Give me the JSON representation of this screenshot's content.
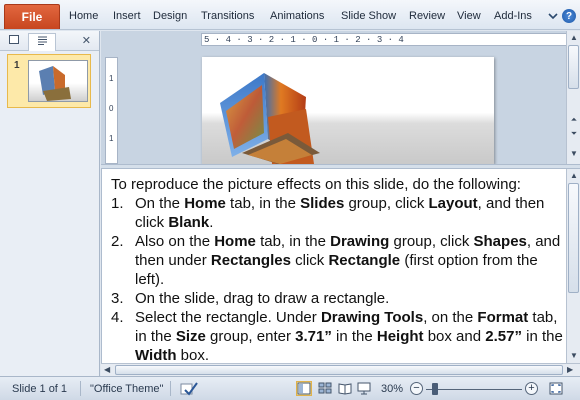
{
  "ribbon": {
    "file_label": "File",
    "tabs": [
      "Home",
      "Insert",
      "Design",
      "Transitions",
      "Animations",
      "Slide Show",
      "Review",
      "View",
      "Add-Ins"
    ],
    "help_label": "?"
  },
  "slides_pane": {
    "thumbnail_number": "1"
  },
  "ruler": {
    "horizontal": "5 · 4 · 3 · 2 · 1 · 0 · 1 · 2 · 3 · 4",
    "vertical": [
      "1",
      "0",
      "1"
    ]
  },
  "notes": {
    "intro": "To reproduce the picture effects on this slide, do the following:",
    "steps": [
      {
        "num": "1.",
        "parts": [
          {
            "t": "On the "
          },
          {
            "b": "Home"
          },
          {
            "t": " tab, in the "
          },
          {
            "b": "Slides"
          },
          {
            "t": " group, click "
          },
          {
            "b": "Layout"
          },
          {
            "t": ", and then click "
          },
          {
            "b": "Blank"
          },
          {
            "t": "."
          }
        ]
      },
      {
        "num": "2.",
        "parts": [
          {
            "t": "Also on the "
          },
          {
            "b": "Home"
          },
          {
            "t": " tab, in the "
          },
          {
            "b": "Drawing"
          },
          {
            "t": " group, click "
          },
          {
            "b": "Shapes"
          },
          {
            "t": ", and then under "
          },
          {
            "b": "Rectangles"
          },
          {
            "t": " click "
          },
          {
            "b": "Rectangle"
          },
          {
            "t": " (first option from the left)."
          }
        ]
      },
      {
        "num": "3.",
        "parts": [
          {
            "t": "On the slide, drag to draw a rectangle."
          }
        ]
      },
      {
        "num": "4.",
        "parts": [
          {
            "t": "Select the rectangle. Under "
          },
          {
            "b": "Drawing Tools"
          },
          {
            "t": ", on the "
          },
          {
            "b": "Format"
          },
          {
            "t": " tab, in the "
          },
          {
            "b": "Size"
          },
          {
            "t": " group, enter "
          },
          {
            "b": "3.71”"
          },
          {
            "t": " in the "
          },
          {
            "b": "Height"
          },
          {
            "t": " box and "
          },
          {
            "b": "2.57”"
          },
          {
            "t": " in the "
          },
          {
            "b": "Width"
          },
          {
            "t": " box."
          }
        ]
      }
    ]
  },
  "status_bar": {
    "slide_info": "Slide 1 of 1",
    "theme": "\"Office Theme\"",
    "zoom": "30%",
    "zoom_minus": "−",
    "zoom_plus": "+"
  },
  "colors": {
    "file_tab": "#d0532b",
    "accent": "#2b5797"
  }
}
